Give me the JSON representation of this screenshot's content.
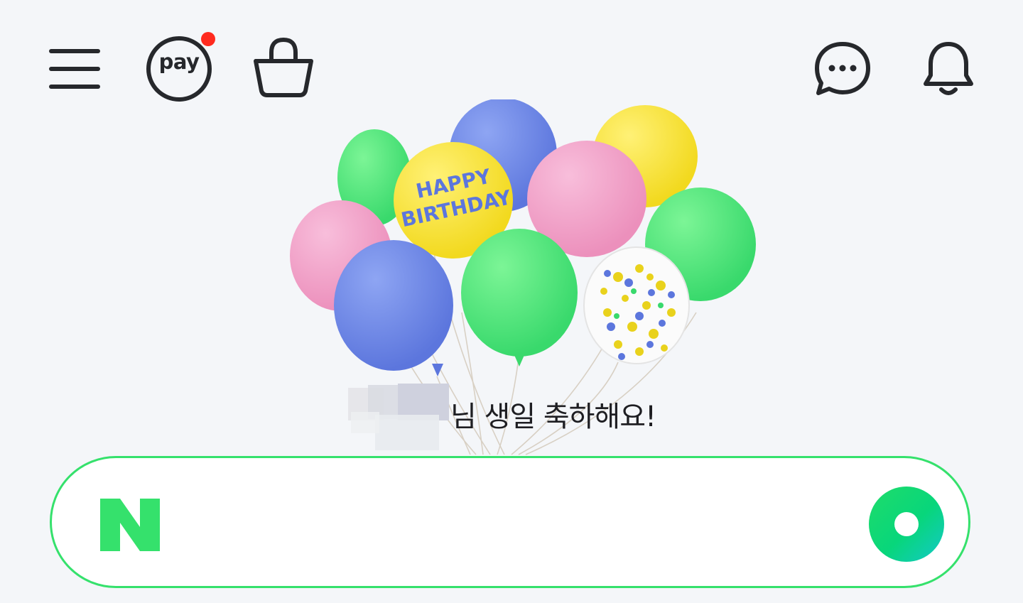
{
  "header": {
    "pay_label": "pay",
    "icons": [
      "menu-icon",
      "pay-icon",
      "shopping-bag-icon",
      "chat-bubble-icon",
      "bell-icon"
    ],
    "notification_dot_color": "#ff2a1f"
  },
  "hero": {
    "balloon_text_line1": "HAPPY",
    "balloon_text_line2": "BIRTHDAY",
    "greeting_suffix": "님 생일 축하해요!"
  },
  "search": {
    "logo_letter": "N",
    "placeholder": "",
    "accent_color": "#35e16c"
  }
}
